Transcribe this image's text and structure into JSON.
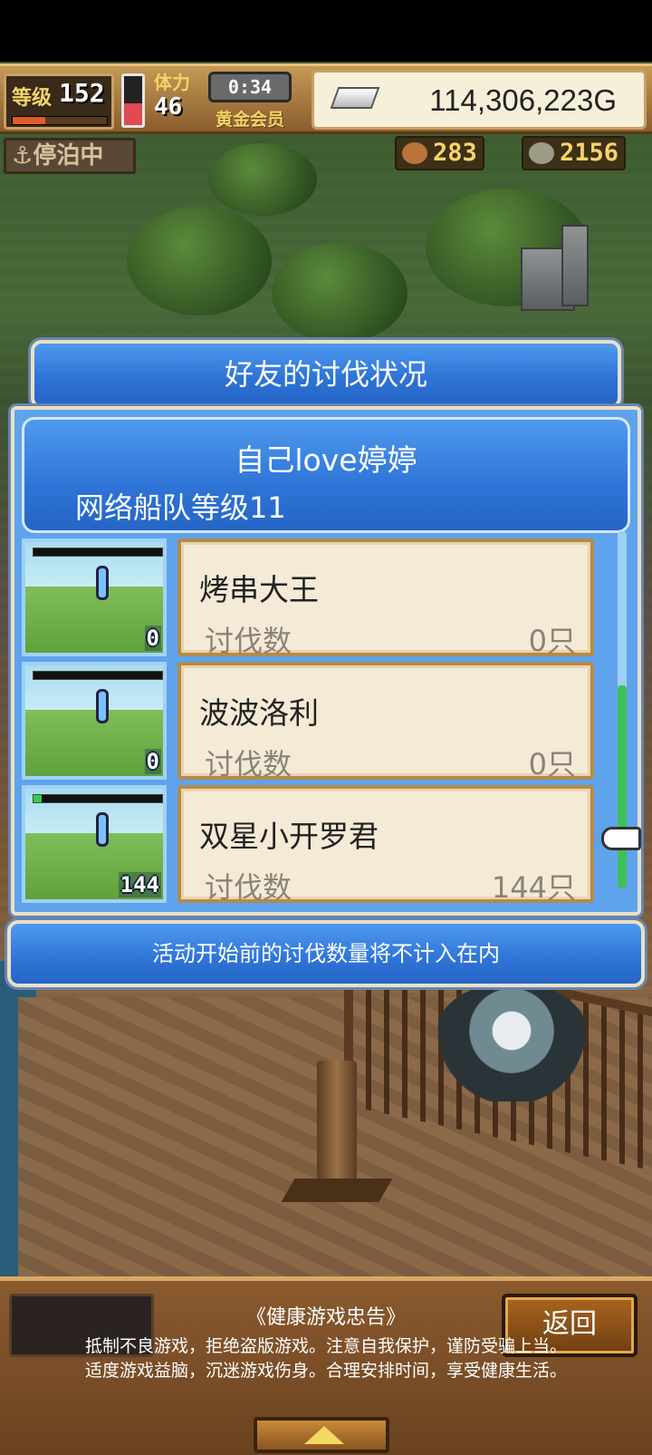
{
  "status": {
    "level_label": "等级",
    "level": "152",
    "level_progress": 0.35,
    "stamina_fraction": 0.45,
    "stamina_label": "体力",
    "stamina": "46",
    "timer": "0:34",
    "membership": "黄金会员",
    "gold": "114,306,223G",
    "anchor_status": "停泊中",
    "resource_1": "283",
    "resource_2": "2156"
  },
  "dialog": {
    "title": "好友的讨伐状况",
    "player_name": "自己love婷婷",
    "fleet_level": "网络船队等级11",
    "kill_label": "讨伐数",
    "entries": [
      {
        "name": "烤串大王",
        "count": "0只",
        "badge": "0",
        "hp": 0.0
      },
      {
        "name": "波波洛利",
        "count": "0只",
        "badge": "0",
        "hp": 0.0
      },
      {
        "name": "双星小开罗君",
        "count": "144只",
        "badge": "144",
        "hp": 0.06
      }
    ],
    "notice": "活动开始前的讨伐数量将不计入在内"
  },
  "bottom": {
    "back_label": "返回",
    "advisory_title": "《健康游戏忠告》",
    "advisory_line1": "抵制不良游戏，拒绝盗版游戏。注意自我保护，谨防受骗上当。",
    "advisory_line2": "适度游戏益脑，沉迷游戏伤身。合理安排时间，享受健康生活。"
  },
  "colors": {
    "dialog_blue": "#2e74d6",
    "card_bg": "#f4ead6",
    "hp_green": "#2fd042",
    "stamina_red": "#e04a52"
  }
}
